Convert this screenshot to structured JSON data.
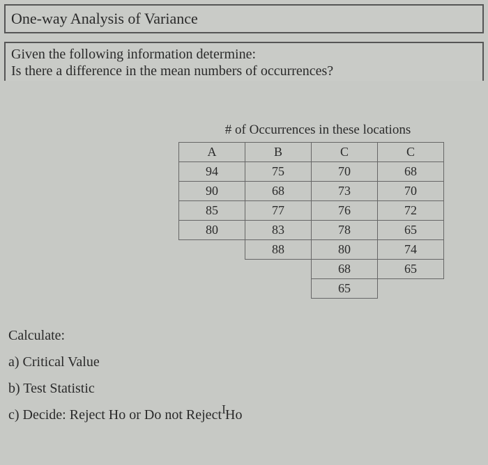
{
  "title": "One-way  Analysis of Variance",
  "given": {
    "line1": "Given the following information determine:",
    "line2": "Is there a difference in the mean numbers of occurrences?"
  },
  "table": {
    "caption": "# of Occurrences in these locations",
    "headers": [
      "A",
      "B",
      "C",
      "C"
    ],
    "rows": [
      [
        "94",
        "75",
        "70",
        "68"
      ],
      [
        "90",
        "68",
        "73",
        "70"
      ],
      [
        "85",
        "77",
        "76",
        "72"
      ],
      [
        "80",
        "83",
        "78",
        "65"
      ],
      [
        "",
        "88",
        "80",
        "74"
      ],
      [
        "",
        "",
        "68",
        "65"
      ],
      [
        "",
        "",
        "65",
        ""
      ]
    ]
  },
  "calc": {
    "heading": "Calculate:",
    "a": "a) Critical Value",
    "b": "b) Test Statistic",
    "c": "c) Decide: Reject Ho or Do not Reject Ho"
  },
  "cursor": "I"
}
